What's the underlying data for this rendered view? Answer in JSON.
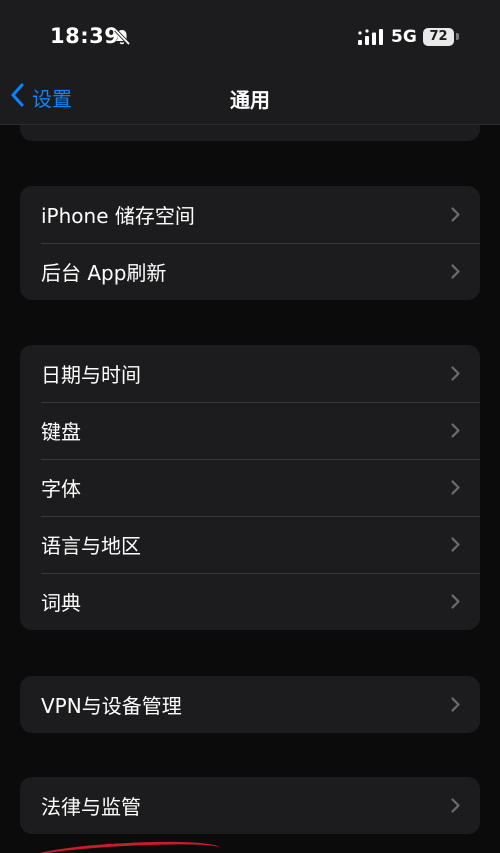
{
  "status_bar": {
    "time": "18:39",
    "network": "5G",
    "battery": "72",
    "icons": [
      "bell-slash-icon",
      "signal-bars-icon",
      "battery-icon"
    ]
  },
  "nav": {
    "back_label": "设置",
    "title": "通用",
    "accent_color": "#0a84ff"
  },
  "groups": [
    {
      "items": [
        "iPhone 储存空间",
        "后台 App刷新"
      ]
    },
    {
      "items": [
        "日期与时间",
        "键盘",
        "字体",
        "语言与地区",
        "词典"
      ]
    },
    {
      "items": [
        "VPN与设备管理"
      ]
    },
    {
      "items": [
        "法律与监管"
      ]
    }
  ],
  "colors": {
    "background": "#0b0b0c",
    "cell": "#1c1c1e",
    "separator": "#38383a",
    "chevron": "#6c6c70"
  }
}
